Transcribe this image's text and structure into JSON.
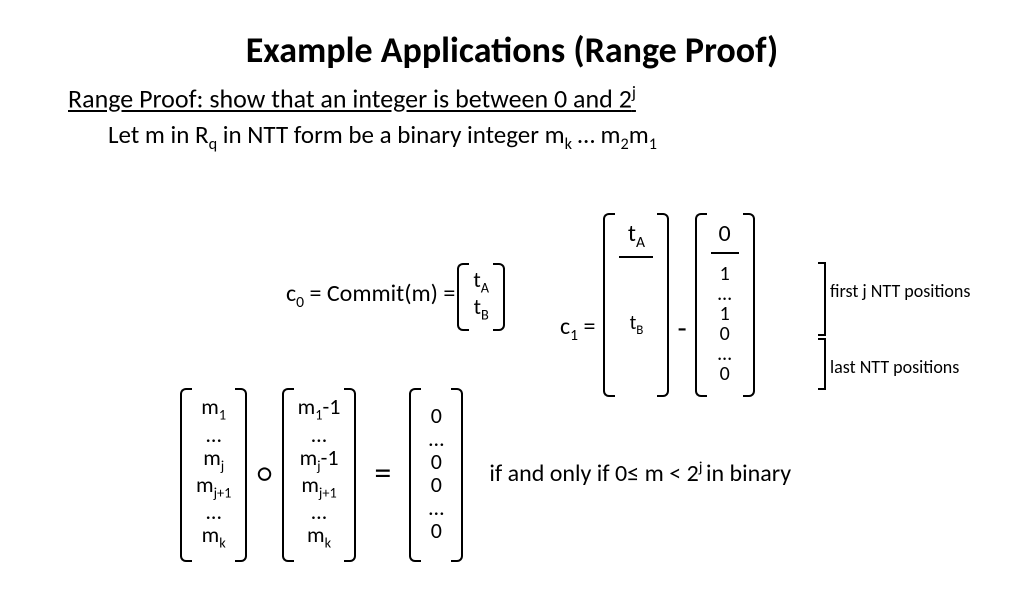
{
  "title": "Example Applications (Range Proof)",
  "section_heading_pre": "Range Proof: show that an integer is between 0 and 2",
  "section_heading_sup": "j",
  "let_line": {
    "pre": "Let m in R",
    "q": "q",
    "mid": " in NTT form be a binary integer m",
    "k": "k",
    "dots": " … m",
    "two": "2",
    "m": "m",
    "one": "1"
  },
  "commit": {
    "lhs_c": "c",
    "lhs_sub": "0",
    "eq": " = Commit(m) = ",
    "vec": {
      "t": "t",
      "A": "A",
      "B": "B"
    }
  },
  "c1": {
    "lbl_c": "c",
    "lbl_sub": "1",
    "eq": " = ",
    "left": {
      "t": "t",
      "A": "A",
      "B": "B"
    },
    "right_top": "0",
    "right_rest": [
      "1",
      "…",
      "1",
      "0",
      "…",
      "0"
    ]
  },
  "annot": {
    "first": "first j NTT positions",
    "last": "last NTT positions"
  },
  "iff": {
    "m1": [
      "m",
      "…",
      "m",
      "m",
      "…",
      "m"
    ],
    "m1_sub": [
      "1",
      "",
      "j",
      "j+1",
      "",
      "k"
    ],
    "m2": [
      "m",
      "…",
      "m",
      "m",
      "…",
      "m"
    ],
    "m2_suffix": [
      "-1",
      "",
      "-1",
      "",
      "",
      ""
    ],
    "m2_sub": [
      "1",
      "",
      "j",
      "j+1",
      "",
      "k"
    ],
    "zero": [
      "0",
      "…",
      "0",
      "0",
      "…",
      "0"
    ],
    "circ": "○",
    "eq": "=",
    "text_pre": "if and only if 0≤ m < 2",
    "text_sup": "j ",
    "text_post": "in binary"
  }
}
